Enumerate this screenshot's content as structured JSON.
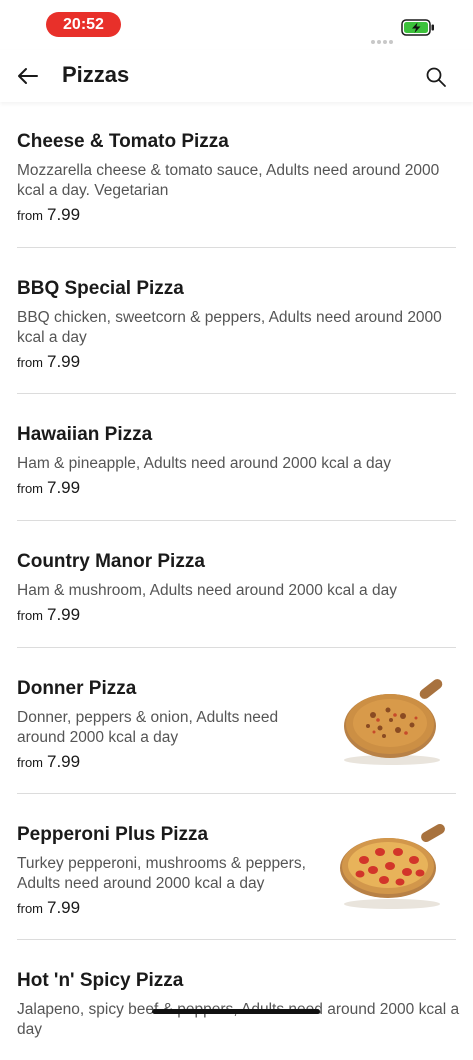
{
  "status": {
    "time": "20:52"
  },
  "header": {
    "title": "Pizzas"
  },
  "items": [
    {
      "name": "Cheese & Tomato Pizza",
      "desc": "Mozzarella cheese & tomato sauce, Adults need around 2000 kcal a day. Vegetarian",
      "from": "from",
      "price": "7.99"
    },
    {
      "name": "BBQ Special Pizza",
      "desc": "BBQ chicken, sweetcorn & peppers, Adults need around 2000 kcal a day",
      "from": "from",
      "price": "7.99"
    },
    {
      "name": "Hawaiian Pizza",
      "desc": "Ham & pineapple, Adults need around 2000 kcal a day",
      "from": "from",
      "price": "7.99"
    },
    {
      "name": "Country Manor Pizza",
      "desc": "Ham & mushroom, Adults need around 2000 kcal a day",
      "from": "from",
      "price": "7.99"
    },
    {
      "name": "Donner Pizza",
      "desc": "Donner, peppers & onion, Adults need around 2000 kcal a day",
      "from": "from",
      "price": "7.99"
    },
    {
      "name": "Pepperoni Plus Pizza",
      "desc": "Turkey pepperoni, mushrooms & peppers, Adults need around 2000 kcal a day",
      "from": "from",
      "price": "7.99"
    },
    {
      "name": "Hot 'n' Spicy Pizza",
      "desc": "Jalapeno, spicy beef & peppers, Adults need around 2000 kcal a day"
    }
  ],
  "colors": {
    "accent": "#e8302a",
    "battery": "#3cc13b"
  }
}
